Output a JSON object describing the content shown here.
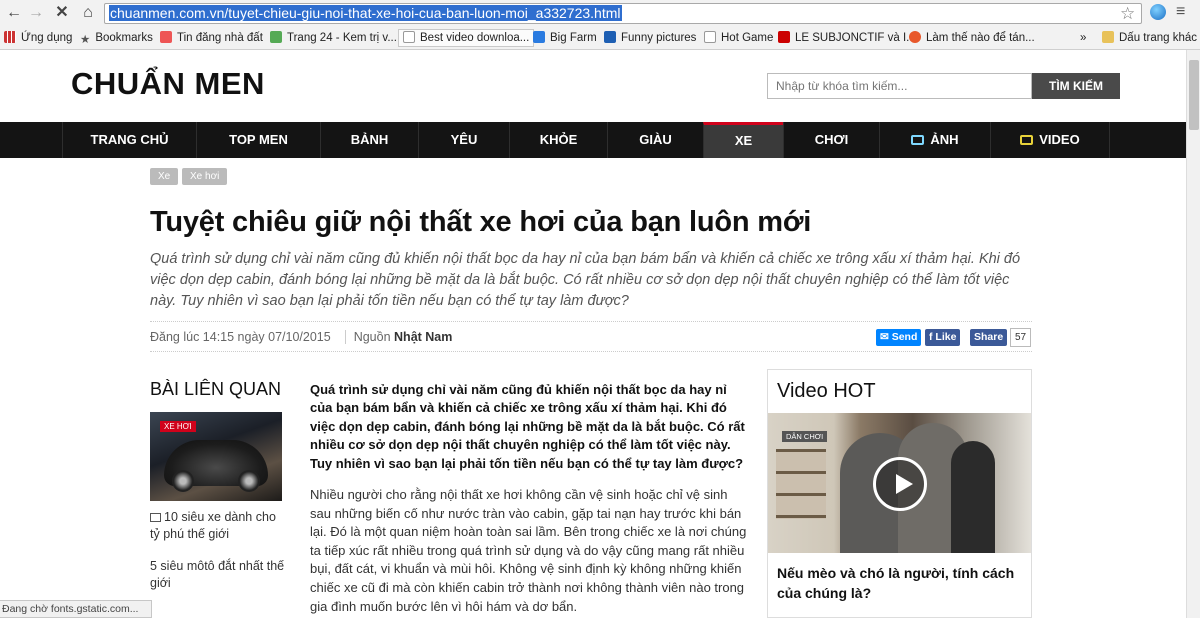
{
  "browser": {
    "url": "chuanmen.com.vn/tuyet-chieu-giu-noi-that-xe-hoi-cua-ban-luon-moi_a332723.html",
    "bookmarks": [
      {
        "label": "Ứng dụng",
        "icon": "apps-icon"
      },
      {
        "label": "Bookmarks",
        "icon": "star-icon"
      },
      {
        "label": "Tin đăng nhà đất",
        "icon": "site-icon"
      },
      {
        "label": "Trang 24 - Kem trị v...",
        "icon": "leaf-icon"
      },
      {
        "label": "Best video downloa...",
        "icon": "page-icon"
      },
      {
        "label": "Big Farm",
        "icon": "game-icon"
      },
      {
        "label": "Funny pictures",
        "icon": "picture-icon"
      },
      {
        "label": "Hot Game",
        "icon": "page-icon"
      },
      {
        "label": "LE SUBJONCTIF và I...",
        "icon": "site-icon"
      },
      {
        "label": "Làm thế nào để tán...",
        "icon": "heart-icon"
      },
      {
        "label": "»",
        "icon": ""
      },
      {
        "label": "Dấu trang khác",
        "icon": "folder-icon"
      }
    ],
    "status": "Đang chờ fonts.gstatic.com..."
  },
  "site": {
    "logo": "CHUẨN MEN",
    "search_placeholder": "Nhập từ khóa tìm kiếm...",
    "search_button": "TÌM KIẾM"
  },
  "nav": [
    "TRANG CHỦ",
    "TOP MEN",
    "BẢNH",
    "YÊU",
    "KHỎE",
    "GIÀU",
    "XE",
    "CHƠI",
    "ẢNH",
    "VIDEO"
  ],
  "tags": [
    "Xe",
    "Xe hơi"
  ],
  "article": {
    "title": "Tuyệt chiêu giữ nội thất xe hơi của bạn luôn mới",
    "sapo": "Quá trình sử dụng chỉ vài năm cũng đủ khiến nội thất bọc da hay nỉ của bạn bám bẩn và khiến cả chiếc xe trông xấu xí thảm hại. Khi đó việc dọn dẹp cabin, đánh bóng lại những bề mặt da là bắt buộc. Có rất nhiều cơ sở dọn dẹp nội thất chuyên nghiệp có thể làm tốt việc này. Tuy nhiên vì sao bạn lại phải tốn tiền nếu bạn có thể tự tay làm được?",
    "posted": "Đăng lúc 14:15 ngày 07/10/2015",
    "source_label": "Nguồn",
    "source_name": "Nhật Nam",
    "share": {
      "send": "Send",
      "like": "Like",
      "share": "Share",
      "count": "57"
    },
    "lead": "Quá trình sử dụng chỉ vài năm cũng đủ khiến nội thất bọc da hay nỉ của bạn bám bẩn và khiến cả chiếc xe trông xấu xí thảm hại. Khi đó việc dọn dẹp cabin, đánh bóng lại những bề mặt da là bắt buộc. Có rất nhiều cơ sở dọn dẹp nội thất chuyên nghiệp có thể làm tốt việc này. Tuy nhiên vì sao bạn lại phải tốn tiền nếu bạn có thể tự tay làm được?",
    "body": "Nhiều người cho rằng nội thất xe hơi không cần vệ sinh hoặc chỉ vệ sinh sau những biến cố như nước tràn vào cabin, gặp tai nạn hay trước khi bán lại. Đó là một quan niệm hoàn toàn sai lầm. Bên trong chiếc xe là nơi chúng ta tiếp xúc rất nhiều trong quá trình sử dụng và do vậy cũng mang rất nhiều bụi, đất cát, vi khuẩn và mùi hôi. Không vệ sinh định kỳ không những khiến chiếc xe cũ đi mà còn khiến cabin trở thành nơi không thành viên nào trong gia đình muốn bước lên vì hôi hám và dơ bẩn."
  },
  "related": {
    "title": "BÀI LIÊN QUAN",
    "image_badge": "XE HƠI",
    "items": [
      "10 siêu xe dành cho tỷ phú thế giới",
      "5 siêu môtô đắt nhất thế giới"
    ]
  },
  "video_hot": {
    "title": "Video HOT",
    "badge": "DÂN CHƠI",
    "caption": "Nếu mèo và chó là người, tính cách của chúng là?"
  },
  "colors": {
    "accent": "#d0021b",
    "nav_bg": "#141414",
    "fb_blue": "#3b5998",
    "messenger": "#0084ff"
  }
}
